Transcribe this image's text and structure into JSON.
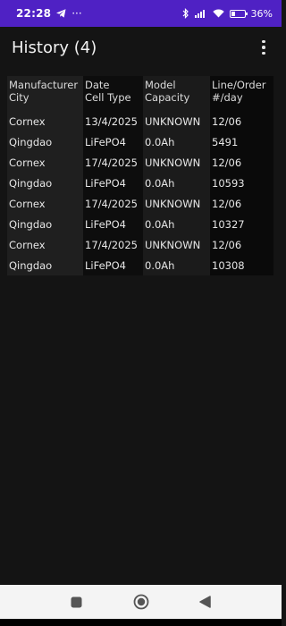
{
  "status_bar": {
    "time": "22:28",
    "more": "···",
    "battery_percent": "36%",
    "battery_level": 0.36,
    "icons": [
      "telegram-icon",
      "bluetooth-icon",
      "signal-icon",
      "wifi-icon",
      "battery-icon"
    ]
  },
  "app_bar": {
    "title": "History (4)",
    "overflow_icon": "overflow-menu-icon"
  },
  "table": {
    "headers": [
      [
        "Manufacturer",
        "City"
      ],
      [
        "Date",
        "Cell Type"
      ],
      [
        "Model",
        "Capacity"
      ],
      [
        "Line/Order",
        "#/day"
      ]
    ],
    "rows": [
      [
        [
          "Cornex",
          "Qingdao"
        ],
        [
          "13/4/2025",
          "LiFePO4"
        ],
        [
          "UNKNOWN",
          "0.0Ah"
        ],
        [
          "12/06",
          "5491"
        ]
      ],
      [
        [
          "Cornex",
          "Qingdao"
        ],
        [
          "17/4/2025",
          "LiFePO4"
        ],
        [
          "UNKNOWN",
          "0.0Ah"
        ],
        [
          "12/06",
          "10593"
        ]
      ],
      [
        [
          "Cornex",
          "Qingdao"
        ],
        [
          "17/4/2025",
          "LiFePO4"
        ],
        [
          "UNKNOWN",
          "0.0Ah"
        ],
        [
          "12/06",
          "10327"
        ]
      ],
      [
        [
          "Cornex",
          "Qingdao"
        ],
        [
          "17/4/2025",
          "LiFePO4"
        ],
        [
          "UNKNOWN",
          "0.0Ah"
        ],
        [
          "12/06",
          "10308"
        ]
      ]
    ]
  },
  "nav_bar": {
    "icons": [
      "recents-square-icon",
      "home-circle-icon",
      "back-triangle-icon"
    ]
  },
  "colors": {
    "status_bar_bg": "#4f21c4",
    "background": "#141414",
    "nav_bar_bg": "#f4f4f4"
  }
}
